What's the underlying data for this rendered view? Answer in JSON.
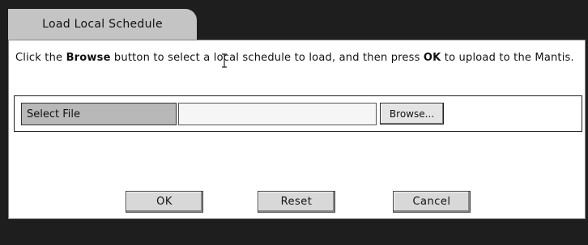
{
  "tab": {
    "label": "Load Local Schedule"
  },
  "instructions": {
    "part1": "Click the ",
    "bold1": "Browse",
    "part2": " button to select a local schedule to load, and then press ",
    "bold2": "OK",
    "part3": " to upload to the Mantis."
  },
  "file_row": {
    "label": "Select File",
    "input_value": "",
    "browse_label": "Browse..."
  },
  "buttons": {
    "ok": "OK",
    "reset": "Reset",
    "cancel": "Cancel"
  },
  "icons": {
    "cursor": "text-cursor-icon"
  }
}
